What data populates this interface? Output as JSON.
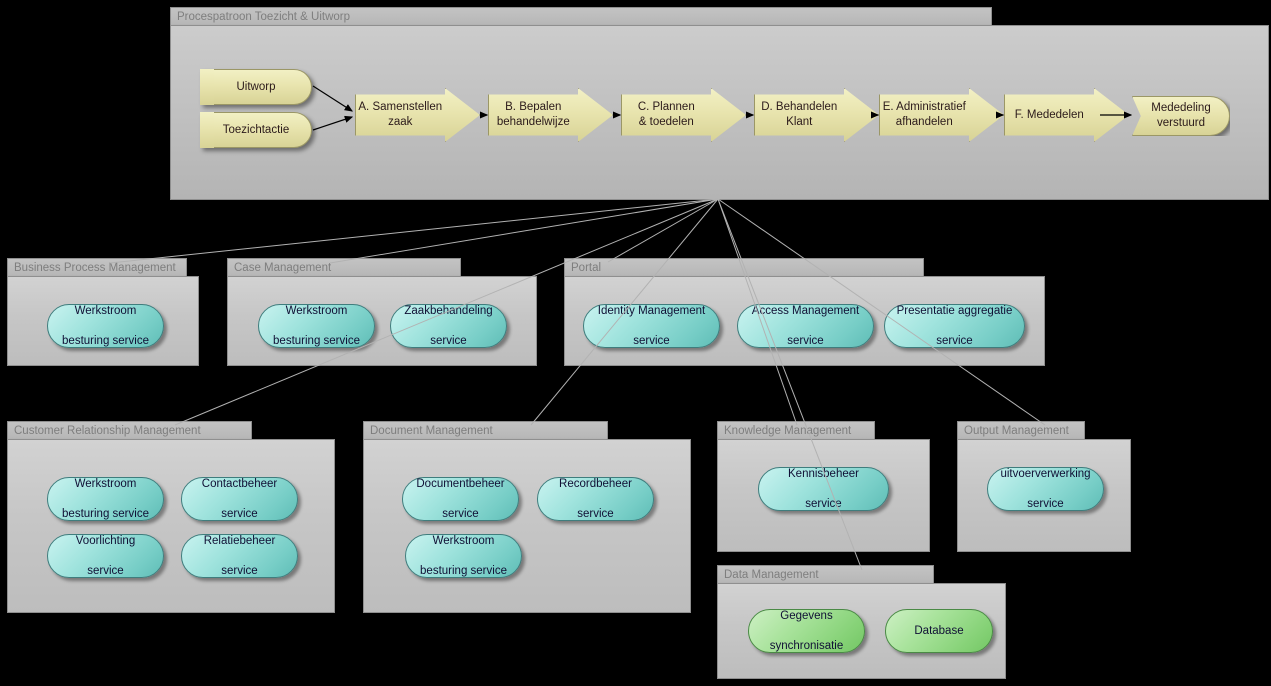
{
  "diagram": {
    "title": "Procespatroon Toezicht & Uitworp"
  },
  "process": {
    "triggers": [
      {
        "label": "Uitworp"
      },
      {
        "label": "Toezichtactie"
      }
    ],
    "steps": [
      {
        "label": "A.   Samenstellen zaak",
        "line1": "A.   Samenstellen",
        "line2": "zaak"
      },
      {
        "label": "B.   Bepalen behandelwijze",
        "line1": "B.   Bepalen",
        "line2": "behandelwijze"
      },
      {
        "label": "C.   Plannen & toedelen",
        "line1": "C.   Plannen",
        "line2": "& toedelen"
      },
      {
        "label": "D.   Behandelen Klant",
        "line1": "D.   Behandelen",
        "line2": "Klant"
      },
      {
        "label": "E. Administratief afhandelen",
        "line1": "E. Administratief",
        "line2": "afhandelen"
      },
      {
        "label": "F.   Mededelen",
        "line1": "F.   Mededelen",
        "line2": ""
      }
    ],
    "end": {
      "line1": "Mededeling",
      "line2": "verstuurd"
    }
  },
  "packages": [
    {
      "id": "business-process-management",
      "title": "Business Process Management",
      "services": [
        {
          "line1": "Werkstroom",
          "line2": "besturing service",
          "color": "cyan"
        }
      ]
    },
    {
      "id": "case-management",
      "title": "Case Management",
      "services": [
        {
          "line1": "Werkstroom",
          "line2": "besturing service",
          "color": "cyan"
        },
        {
          "line1": "Zaakbehandeling",
          "line2": "service",
          "color": "cyan"
        }
      ]
    },
    {
      "id": "portal",
      "title": "Portal",
      "services": [
        {
          "line1": "Identity Management",
          "line2": "service",
          "color": "cyan"
        },
        {
          "line1": "Access Management",
          "line2": "service",
          "color": "cyan"
        },
        {
          "line1": "Presentatie aggregatie",
          "line2": "service",
          "color": "cyan"
        }
      ]
    },
    {
      "id": "customer-relationship-management",
      "title": "Customer Relationship Management",
      "services": [
        {
          "line1": "Werkstroom",
          "line2": "besturing service",
          "color": "cyan"
        },
        {
          "line1": "Contactbeheer",
          "line2": "service",
          "color": "cyan"
        },
        {
          "line1": "Voorlichting",
          "line2": "service",
          "color": "cyan"
        },
        {
          "line1": "Relatiebeheer",
          "line2": "service",
          "color": "cyan"
        }
      ]
    },
    {
      "id": "document-management",
      "title": "Document Management",
      "services": [
        {
          "line1": "Documentbeheer",
          "line2": "service",
          "color": "cyan"
        },
        {
          "line1": "Recordbeheer",
          "line2": "service",
          "color": "cyan"
        },
        {
          "line1": "Werkstroom",
          "line2": "besturing service",
          "color": "cyan"
        }
      ]
    },
    {
      "id": "knowledge-management",
      "title": "Knowledge Management",
      "services": [
        {
          "line1": "Kennisbeheer",
          "line2": "service",
          "color": "cyan"
        }
      ]
    },
    {
      "id": "output-management",
      "title": "Output Management",
      "services": [
        {
          "line1": "uitvoerverwerking",
          "line2": "service",
          "color": "cyan"
        }
      ]
    },
    {
      "id": "data-management",
      "title": "Data Management",
      "services": [
        {
          "line1": "Gegevens",
          "line2": "synchronisatie",
          "color": "green"
        },
        {
          "line1": "Database",
          "line2": "",
          "color": "green"
        }
      ]
    }
  ],
  "colors": {
    "background": "#000000",
    "package_tab": "#c0c0c0",
    "package_body": "#c6c6c6",
    "package_border": "#8f8f8f",
    "package_title_text": "#7e7e7e",
    "service_cyan": "#8fdcd6",
    "service_green": "#97da88",
    "process_yellow": "#e5e1ab",
    "connector": "#b0b0b0"
  }
}
